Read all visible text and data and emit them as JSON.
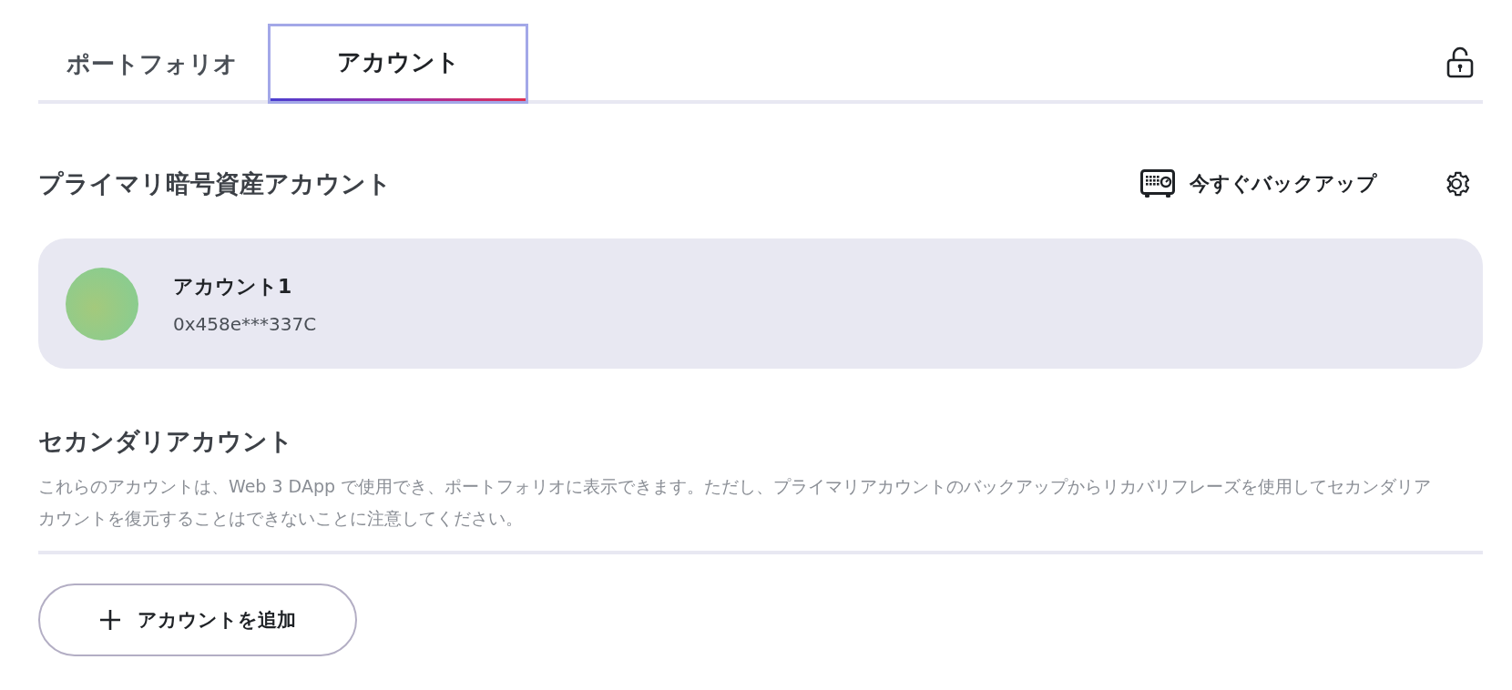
{
  "tabs": [
    {
      "label": "ポートフォリオ",
      "selected": false
    },
    {
      "label": "アカウント",
      "selected": true
    }
  ],
  "lock": {
    "locked": false
  },
  "primary": {
    "title": "プライマリ暗号資産アカウント",
    "backup_label": "今すぐバックアップ",
    "accounts": [
      {
        "name": "アカウント1",
        "address": "0x458e***337C",
        "selected": true
      }
    ]
  },
  "secondary": {
    "title": "セカンダリアカウント",
    "description": "これらのアカウントは、Web 3 DApp で使用でき、ポートフォリオに表示できます。ただし、プライマリアカウントのバックアップからリカバリフレーズを使用してセカンダリアカウントを復元することはできないことに注意してください。",
    "add_label": "アカウントを追加"
  }
}
